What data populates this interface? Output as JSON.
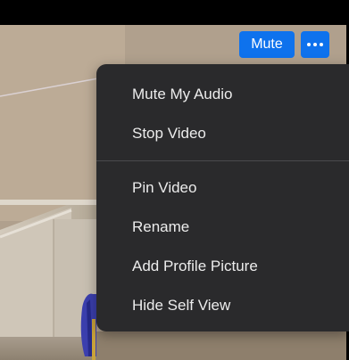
{
  "controls": {
    "mute_label": "Mute",
    "more_icon": "ellipsis-icon",
    "accent_color": "#0e72ed"
  },
  "menu": {
    "group1": [
      {
        "label": "Mute My Audio"
      },
      {
        "label": "Stop Video"
      }
    ],
    "group2": [
      {
        "label": "Pin Video"
      },
      {
        "label": "Rename"
      },
      {
        "label": "Add Profile Picture"
      },
      {
        "label": "Hide Self View"
      }
    ],
    "background_color": "#2a2a2c",
    "text_color": "#ececec"
  }
}
